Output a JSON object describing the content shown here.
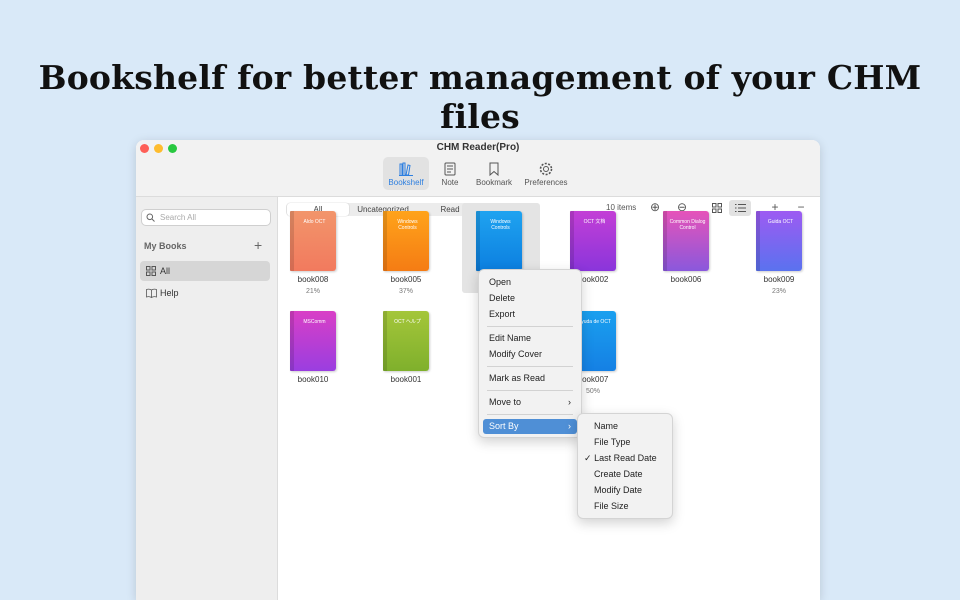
{
  "headline": "Bookshelf for better management of your CHM files",
  "window": {
    "title": "CHM Reader(Pro)",
    "toolbar": [
      {
        "label": "Bookshelf",
        "icon": "bookshelf-icon",
        "active": true
      },
      {
        "label": "Note",
        "icon": "note-icon"
      },
      {
        "label": "Bookmark",
        "icon": "bookmark-icon"
      },
      {
        "label": "Preferences",
        "icon": "gear-icon"
      }
    ]
  },
  "sidebar": {
    "search_placeholder": "Search All",
    "section_title": "My Books",
    "items": [
      {
        "label": "All",
        "icon": "grid-icon",
        "selected": true
      },
      {
        "label": "Help",
        "icon": "book-open-icon"
      }
    ]
  },
  "filter": {
    "tabs": [
      "All",
      "Uncategorized",
      "Read"
    ],
    "selected": "All",
    "count_label": "10 items"
  },
  "books": [
    {
      "name": "book008",
      "cover": "Aldo OCT",
      "progress": "21%",
      "colors": [
        "#f2956b",
        "#f27a5e"
      ]
    },
    {
      "name": "book005",
      "cover": "Windows Controls",
      "progress": "37%",
      "colors": [
        "#ffa31a",
        "#f57c14"
      ]
    },
    {
      "name": "",
      "cover": "Windows Controls",
      "progress": "",
      "colors": [
        "#1fa3f0",
        "#0c7fe0"
      ]
    },
    {
      "name": "book002",
      "cover": "OCT 文档",
      "progress": "",
      "colors": [
        "#c33fd6",
        "#8a35db"
      ]
    },
    {
      "name": "book006",
      "cover": "Common Dialog Control",
      "progress": "",
      "colors": [
        "#e653b9",
        "#8a58dc"
      ]
    },
    {
      "name": "book009",
      "cover": "Guida OCT",
      "progress": "23%",
      "colors": [
        "#9d5bf2",
        "#5a72ef"
      ]
    },
    {
      "name": "book010",
      "cover": "MSComm",
      "progress": "",
      "colors": [
        "#d93fc6",
        "#9a3ee0"
      ]
    },
    {
      "name": "book001",
      "cover": "OCT ヘルプ",
      "progress": "",
      "colors": [
        "#a4c63a",
        "#7fb02c"
      ]
    },
    {
      "name": "book007",
      "cover": "Ayuda de OCT",
      "progress": "50%",
      "colors": [
        "#1aa0ef",
        "#1580e4"
      ]
    }
  ],
  "context_menu": {
    "items": [
      "Open",
      "Delete",
      "Export",
      "Edit Name",
      "Modify Cover",
      "Mark as Read",
      "Move to",
      "Sort By"
    ],
    "highlighted": "Sort By"
  },
  "sort_menu": {
    "items": [
      "Name",
      "File Type",
      "Last Read Date",
      "Create Date",
      "Modify Date",
      "File Size"
    ],
    "checked": "Last Read Date"
  }
}
